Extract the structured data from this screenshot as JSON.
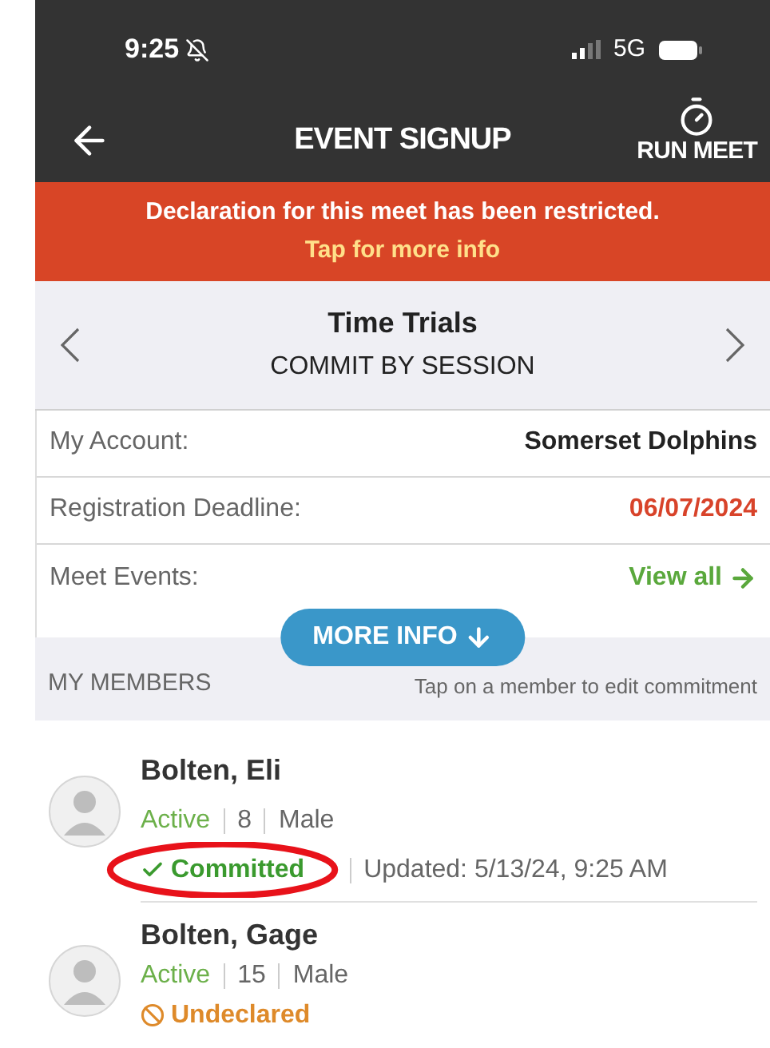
{
  "status_bar": {
    "time": "9:25",
    "network": "5G"
  },
  "header": {
    "title": "EVENT SIGNUP",
    "action": "RUN MEET"
  },
  "banner": {
    "message": "Declaration for this meet has been restricted.",
    "link": "Tap for more info"
  },
  "session": {
    "title": "Time Trials",
    "subtitle": "COMMIT BY SESSION"
  },
  "info_rows": [
    {
      "label": "My Account:",
      "value": "Somerset Dolphins",
      "kind": "text"
    },
    {
      "label": "Registration Deadline:",
      "value": "06/07/2024",
      "kind": "deadline"
    },
    {
      "label": "Meet Events:",
      "value": "View all",
      "kind": "link"
    }
  ],
  "more_info": "MORE INFO",
  "members_header": {
    "title": "MY MEMBERS",
    "hint": "Tap on a member to edit commitment"
  },
  "members": [
    {
      "name": "Bolten, Eli",
      "status": "Active",
      "age": "8",
      "gender": "Male",
      "commitment": {
        "kind": "committed",
        "label": "Committed",
        "updated": "Updated: 5/13/24, 9:25 AM"
      },
      "circled": true
    },
    {
      "name": "Bolten, Gage",
      "status": "Active",
      "age": "15",
      "gender": "Male",
      "commitment": {
        "kind": "undeclared",
        "label": "Undeclared"
      },
      "circled": false
    }
  ]
}
